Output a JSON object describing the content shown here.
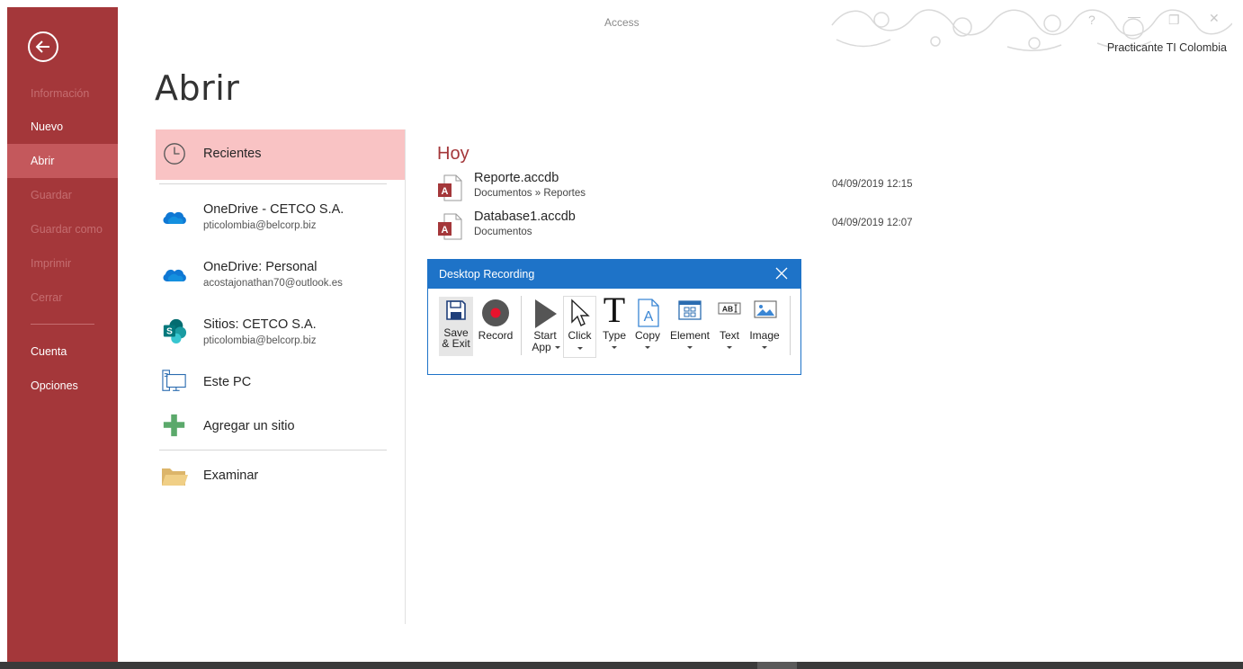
{
  "app": {
    "title": "Access",
    "user": "Practicante TI Colombia"
  },
  "backstage": {
    "items": [
      {
        "label": "Información",
        "state": "disabled"
      },
      {
        "label": "Nuevo",
        "state": "normal"
      },
      {
        "label": "Abrir",
        "state": "active"
      },
      {
        "label": "Guardar",
        "state": "disabled"
      },
      {
        "label": "Guardar como",
        "state": "disabled"
      },
      {
        "label": "Imprimir",
        "state": "disabled"
      },
      {
        "label": "Cerrar",
        "state": "disabled"
      },
      {
        "label": "Cuenta",
        "state": "normal"
      },
      {
        "label": "Opciones",
        "state": "normal"
      }
    ]
  },
  "page": {
    "title": "Abrir"
  },
  "locations": [
    {
      "title": "Recientes",
      "subtitle": "",
      "icon": "clock-icon"
    },
    {
      "title": "OneDrive - CETCO S.A.",
      "subtitle": "pticolombia@belcorp.biz",
      "icon": "onedrive-icon"
    },
    {
      "title": "OneDrive: Personal",
      "subtitle": "acostajonathan70@outlook.es",
      "icon": "onedrive-icon"
    },
    {
      "title": "Sitios: CETCO S.A.",
      "subtitle": "pticolombia@belcorp.biz",
      "icon": "sharepoint-icon"
    },
    {
      "title": "Este PC",
      "subtitle": "",
      "icon": "pc-icon"
    },
    {
      "title": "Agregar un sitio",
      "subtitle": "",
      "icon": "plus-icon"
    },
    {
      "title": "Examinar",
      "subtitle": "",
      "icon": "folder-icon"
    }
  ],
  "recent": {
    "heading": "Hoy",
    "files": [
      {
        "name": "Reporte.accdb",
        "path": "Documentos » Reportes",
        "date": "04/09/2019 12:15"
      },
      {
        "name": "Database1.accdb",
        "path": "Documentos",
        "date": "04/09/2019 12:07"
      }
    ]
  },
  "recorder": {
    "title": "Desktop Recording",
    "tools": [
      {
        "label": "Save",
        "label2": "& Exit",
        "icon": "save-icon"
      },
      {
        "label": "Record",
        "label2": "",
        "icon": "record-icon"
      },
      {
        "label": "Start",
        "label2": "App",
        "icon": "play-icon"
      },
      {
        "label": "Click",
        "label2": "",
        "icon": "cursor-icon"
      },
      {
        "label": "Type",
        "label2": "",
        "icon": "type-icon"
      },
      {
        "label": "Copy",
        "label2": "",
        "icon": "copy-icon"
      },
      {
        "label": "Element",
        "label2": "",
        "icon": "element-icon"
      },
      {
        "label": "Text",
        "label2": "",
        "icon": "text-icon"
      },
      {
        "label": "Image",
        "label2": "",
        "icon": "image-icon"
      }
    ]
  },
  "colors": {
    "accent": "#a4373a",
    "active_nav": "#c4585c",
    "selected_location": "#f9c3c4",
    "recorder_blue": "#1e73c8"
  }
}
